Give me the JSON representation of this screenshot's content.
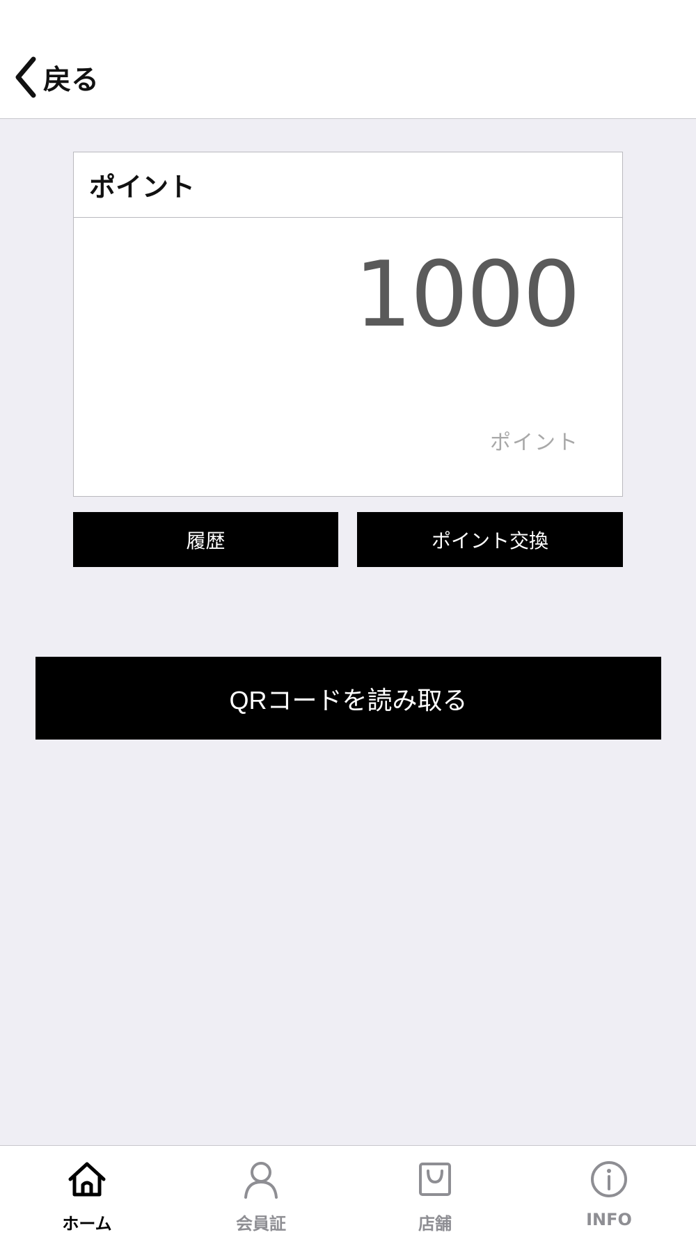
{
  "header": {
    "back_label": "戻る",
    "back_icon": "chevron-left-icon"
  },
  "points_card": {
    "title": "ポイント",
    "value": "1000",
    "unit": "ポイント"
  },
  "actions": {
    "history_label": "履歴",
    "exchange_label": "ポイント交換",
    "qr_label": "QRコードを読み取る"
  },
  "tabbar": {
    "items": [
      {
        "label": "ホーム",
        "icon": "home-icon",
        "active": true
      },
      {
        "label": "会員証",
        "icon": "person-icon",
        "active": false
      },
      {
        "label": "店舗",
        "icon": "shopping-bag-icon",
        "active": false
      },
      {
        "label": "INFO",
        "icon": "info-icon",
        "active": false
      }
    ]
  },
  "colors": {
    "background": "#efeef4",
    "button": "#000000",
    "tab_active": "#000000",
    "tab_inactive": "#8e8e93"
  }
}
